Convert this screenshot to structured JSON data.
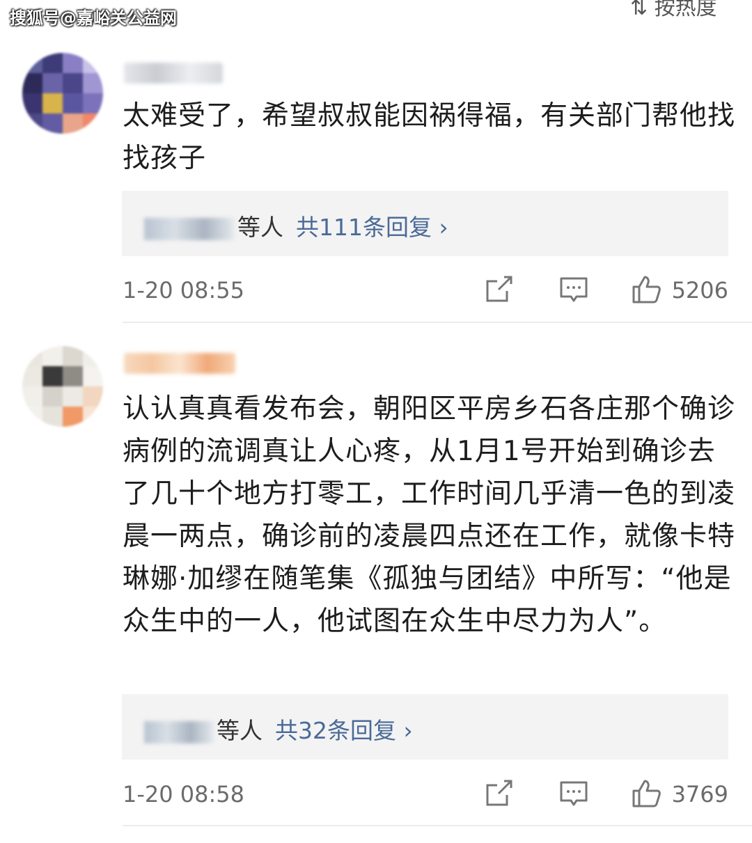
{
  "watermark": "搜狐号@嘉峪关公益网",
  "sort_label": "按热度",
  "comments": [
    {
      "text": "太难受了，希望叔叔能因祸得福，有关部门帮他找找孩子",
      "reply_suffix": "等人",
      "reply_count": "共111条回复 ›",
      "timestamp": "1-20 08:55",
      "likes": "5206"
    },
    {
      "text": "认认真真看发布会，朝阳区平房乡石各庄那个确诊病例的流调真让人心疼，从1月1号开始到确诊去了几十个地方打零工，工作时间几乎清一色的到凌晨一两点，确诊前的凌晨四点还在工作，就像卡特琳娜·加缪在随笔集《孤独与团结》中所写：“他是众生中的一人，他试图在众生中尽力为人”。",
      "reply_suffix": "等人",
      "reply_count": "共32条回复 ›",
      "timestamp": "1-20 08:58",
      "likes": "3769"
    }
  ],
  "icons": {
    "share": "share-icon",
    "comment": "comment-icon",
    "like": "thumbs-up-icon"
  },
  "colors": {
    "link": "#4a6a98",
    "reply_bg": "#f3f3f3",
    "meta_text": "#6b6b6b"
  }
}
